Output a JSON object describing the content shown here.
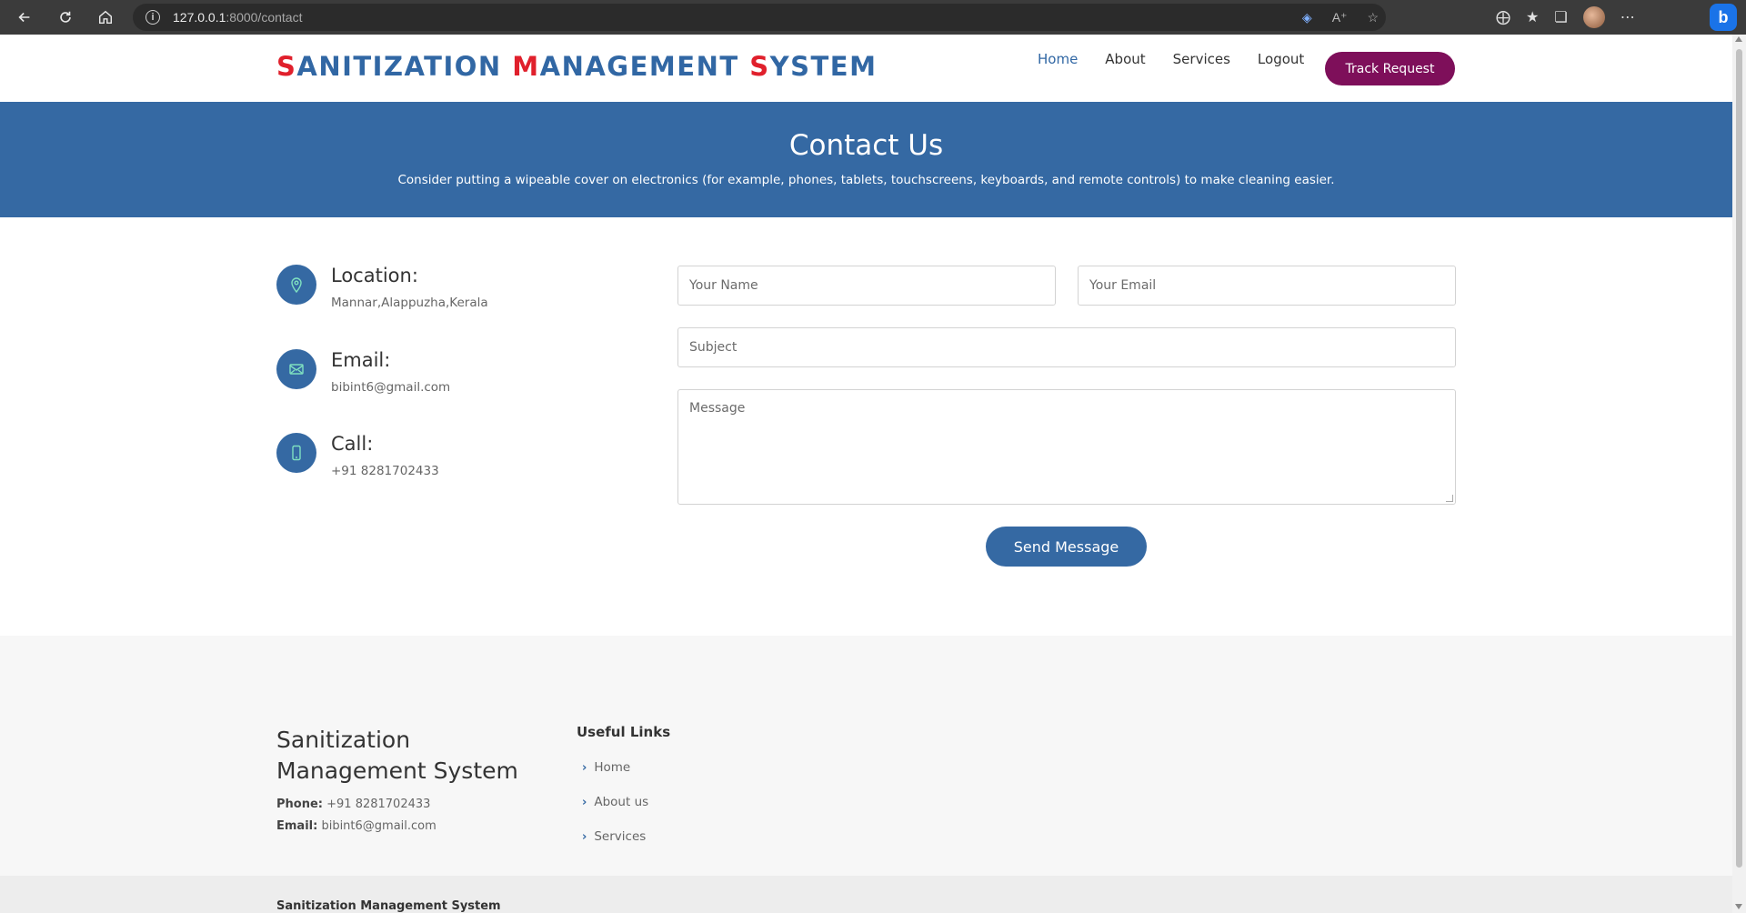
{
  "browser": {
    "url_host": "127.0.0.1",
    "url_path": ":8000/contact",
    "right_icons": [
      "tag-icon",
      "read-aloud-icon",
      "favorite-add-icon",
      "extensions-icon",
      "favorites-icon",
      "collections-icon",
      "profile-avatar",
      "more-icon",
      "bing-icon"
    ]
  },
  "header": {
    "logo": {
      "parts": [
        {
          "text": "S",
          "accent": true
        },
        {
          "text": "ANITIZATION ",
          "accent": false
        },
        {
          "text": "M",
          "accent": true
        },
        {
          "text": "ANAGEMENT ",
          "accent": false
        },
        {
          "text": "S",
          "accent": true
        },
        {
          "text": "YSTEM",
          "accent": false
        }
      ]
    },
    "nav": [
      {
        "label": "Home",
        "active": true
      },
      {
        "label": "About",
        "active": false
      },
      {
        "label": "Services",
        "active": false
      },
      {
        "label": "Logout",
        "active": false
      }
    ],
    "track_button": "Track Request"
  },
  "banner": {
    "title": "Contact Us",
    "subtitle": "Consider putting a wipeable cover on electronics (for example, phones, tablets, touchscreens, keyboards, and remote controls) to make cleaning easier."
  },
  "contact_info": {
    "location_title": "Location:",
    "location_value": "Mannar,Alappuzha,Kerala",
    "email_title": "Email:",
    "email_value": "bibint6@gmail.com",
    "call_title": "Call:",
    "call_value": "+91 8281702433"
  },
  "form": {
    "name_placeholder": "Your Name",
    "email_placeholder": "Your Email",
    "subject_placeholder": "Subject",
    "message_placeholder": "Message",
    "send_label": "Send Message"
  },
  "footer": {
    "brand": "Sanitization Management System",
    "phone_label": "Phone:",
    "phone_value": "+91 8281702433",
    "email_label": "Email:",
    "email_value": "bibint6@gmail.com",
    "links_title": "Useful Links",
    "links": [
      "Home",
      "About us",
      "Services"
    ],
    "copyright_brand": "Sanitization Management System"
  },
  "colors": {
    "primary": "#3569a3",
    "accent_red": "#e0202c",
    "track_button": "#7e0f5a"
  }
}
